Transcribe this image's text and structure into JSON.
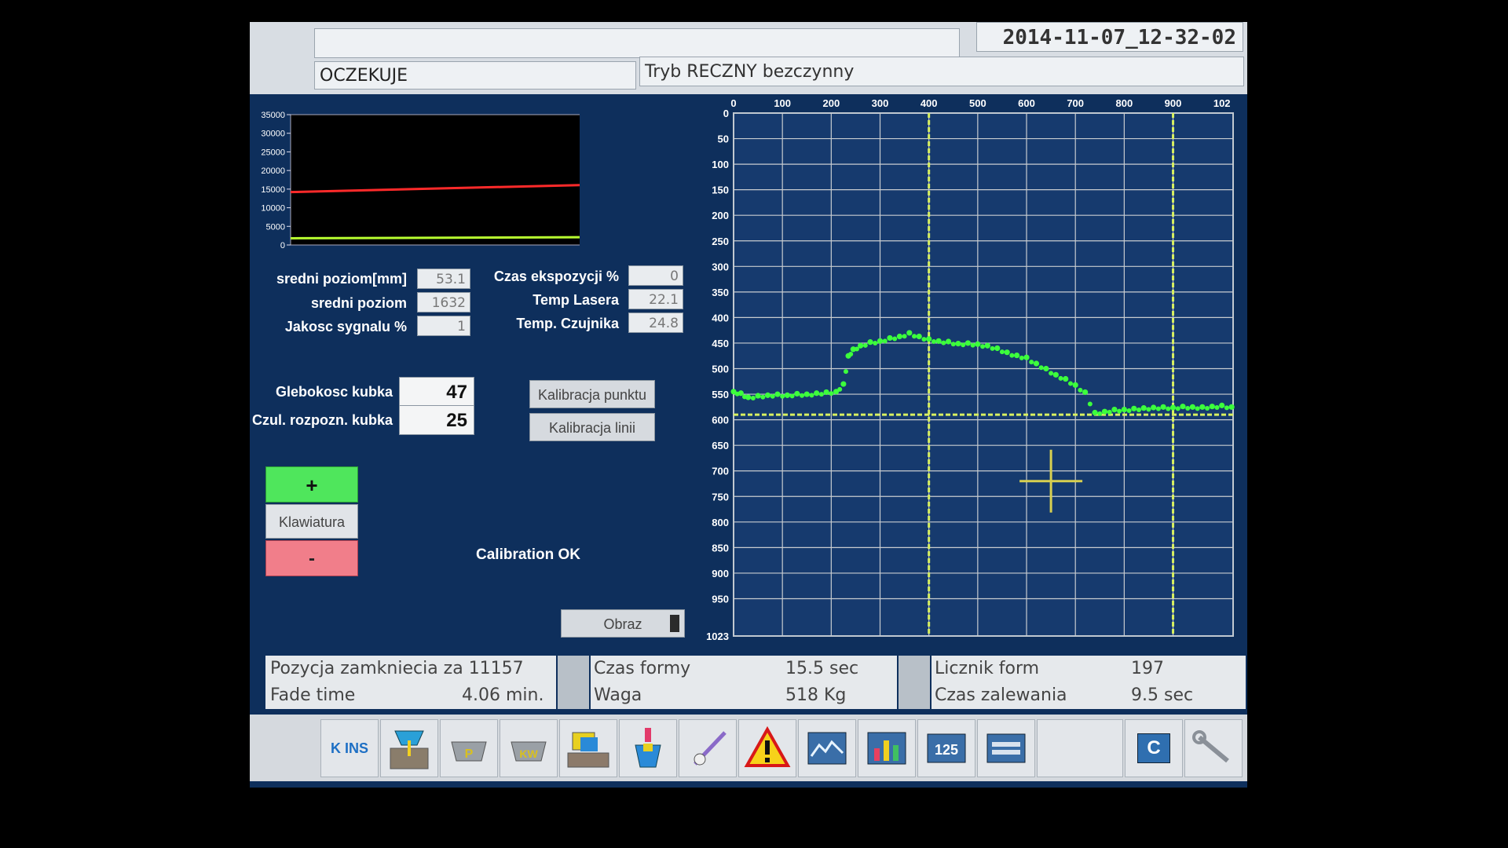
{
  "header": {
    "timestamp": "2014-11-07_12-32-02",
    "status": "OCZEKUJE",
    "mode": "Tryb RECZNY bezczynny"
  },
  "trend_chart": {
    "y_ticks": [
      "35000",
      "30000",
      "25000",
      "20000",
      "15000",
      "10000",
      "5000",
      "0"
    ],
    "series_colors": [
      "#ff2a2a",
      "#b8ff30"
    ]
  },
  "chart_data": [
    {
      "type": "line",
      "ylim": [
        0,
        35000
      ],
      "yticks": [
        0,
        5000,
        10000,
        15000,
        20000,
        25000,
        30000,
        35000
      ],
      "series": [
        {
          "color": "#ff2a2a",
          "x": [
            0,
            1
          ],
          "values": [
            14200,
            16200
          ]
        },
        {
          "color": "#b8ff30",
          "x": [
            0,
            1
          ],
          "values": [
            1800,
            2100
          ]
        }
      ]
    },
    {
      "type": "scatter",
      "xlim": [
        0,
        1023
      ],
      "ylim": [
        1023,
        0
      ],
      "xticks": [
        "0",
        "100",
        "200",
        "300",
        "400",
        "500",
        "600",
        "700",
        "800",
        "900",
        "102"
      ],
      "yticks": [
        "0",
        "50",
        "100",
        "150",
        "200",
        "250",
        "300",
        "350",
        "400",
        "450",
        "500",
        "550",
        "600",
        "650",
        "700",
        "750",
        "800",
        "850",
        "900",
        "950",
        "1023"
      ],
      "profile": {
        "color": "#3cff3c",
        "x": [
          0,
          15,
          30,
          50,
          70,
          90,
          110,
          130,
          150,
          170,
          190,
          210,
          225,
          235,
          245,
          260,
          280,
          300,
          320,
          340,
          360,
          380,
          400,
          420,
          440,
          460,
          480,
          500,
          520,
          540,
          560,
          580,
          600,
          620,
          640,
          660,
          680,
          700,
          720,
          740,
          760,
          780,
          800,
          820,
          840,
          860,
          880,
          900,
          920,
          940,
          960,
          980,
          1000,
          1020
        ],
        "y": [
          545,
          548,
          556,
          553,
          552,
          550,
          552,
          549,
          550,
          548,
          546,
          545,
          530,
          475,
          462,
          455,
          448,
          446,
          440,
          437,
          430,
          437,
          442,
          446,
          447,
          451,
          450,
          452,
          455,
          460,
          468,
          474,
          478,
          490,
          500,
          512,
          520,
          532,
          546,
          586,
          584,
          580,
          580,
          578,
          577,
          576,
          575,
          576,
          574,
          575,
          575,
          574,
          572,
          575
        ]
      },
      "reference_lines": {
        "color": "#d8f060",
        "horizontal_y": [
          590
        ],
        "vertical_x": [
          400,
          900
        ]
      },
      "crosshair": {
        "x": 650,
        "y": 720
      }
    }
  ],
  "readouts": {
    "sredni_poziom_mm": {
      "label": "sredni poziom[mm]",
      "value": "53.1"
    },
    "sredni_poziom": {
      "label": "sredni poziom",
      "value": "1632"
    },
    "jakosc_sygnalu": {
      "label": "Jakosc sygnalu %",
      "value": "1"
    },
    "czas_ekspozycji": {
      "label": "Czas ekspozycji %",
      "value": "0"
    },
    "temp_lasera": {
      "label": "Temp Lasera",
      "value": "22.1"
    },
    "temp_czujnika": {
      "label": "Temp. Czujnika",
      "value": "24.8"
    }
  },
  "settings": {
    "glebokosc": {
      "label": "Glebokosc kubka",
      "value": "47"
    },
    "czulosc": {
      "label": "Czul. rozpozn. kubka",
      "value": "25"
    }
  },
  "buttons": {
    "kalibracja_punktu": "Kalibracja punktu",
    "kalibracja_linii": "Kalibracja linii",
    "plus": "+",
    "klawiatura": "Klawiatura",
    "minus": "-",
    "obraz": "Obraz"
  },
  "calibration_status": "Calibration OK",
  "info": {
    "pozycja_label": "Pozycja zamkniecia za 11157",
    "fade_label": "Fade time",
    "fade_value": "4.06 min.",
    "czas_formy_label": "Czas formy",
    "czas_formy_value": "15.5 sec",
    "waga_label": "Waga",
    "waga_value": "518 Kg",
    "licznik_label": "Licznik form",
    "licznik_value": "197",
    "zalewanie_label": "Czas zalewania",
    "zalewanie_value": "9.5 sec"
  },
  "toolbar": {
    "logo_text": "K INS",
    "counter_text": "125",
    "c_text": "C",
    "p_text": "P",
    "kw_text": "KW",
    "icons": [
      "kons-logo-icon",
      "ladle-pour-icon",
      "ladle-p-icon",
      "ladle-kw-icon",
      "mold-box-icon",
      "stopper-icon",
      "probe-hand-icon",
      "warning-icon",
      "chart-line-icon",
      "bar-chart-icon",
      "counter-icon",
      "screen-icon",
      "blank",
      "c-icon",
      "wrench-icon"
    ]
  }
}
